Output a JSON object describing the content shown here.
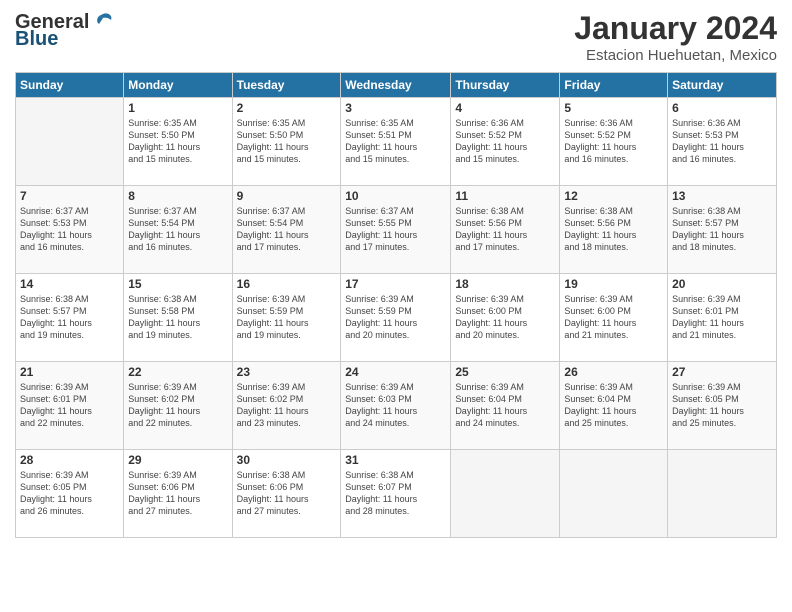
{
  "header": {
    "title": "January 2024",
    "location": "Estacion Huehuetan, Mexico"
  },
  "columns": [
    "Sunday",
    "Monday",
    "Tuesday",
    "Wednesday",
    "Thursday",
    "Friday",
    "Saturday"
  ],
  "weeks": [
    [
      {
        "day": "",
        "info": ""
      },
      {
        "day": "1",
        "info": "Sunrise: 6:35 AM\nSunset: 5:50 PM\nDaylight: 11 hours\nand 15 minutes."
      },
      {
        "day": "2",
        "info": "Sunrise: 6:35 AM\nSunset: 5:50 PM\nDaylight: 11 hours\nand 15 minutes."
      },
      {
        "day": "3",
        "info": "Sunrise: 6:35 AM\nSunset: 5:51 PM\nDaylight: 11 hours\nand 15 minutes."
      },
      {
        "day": "4",
        "info": "Sunrise: 6:36 AM\nSunset: 5:52 PM\nDaylight: 11 hours\nand 15 minutes."
      },
      {
        "day": "5",
        "info": "Sunrise: 6:36 AM\nSunset: 5:52 PM\nDaylight: 11 hours\nand 16 minutes."
      },
      {
        "day": "6",
        "info": "Sunrise: 6:36 AM\nSunset: 5:53 PM\nDaylight: 11 hours\nand 16 minutes."
      }
    ],
    [
      {
        "day": "7",
        "info": "Sunrise: 6:37 AM\nSunset: 5:53 PM\nDaylight: 11 hours\nand 16 minutes."
      },
      {
        "day": "8",
        "info": "Sunrise: 6:37 AM\nSunset: 5:54 PM\nDaylight: 11 hours\nand 16 minutes."
      },
      {
        "day": "9",
        "info": "Sunrise: 6:37 AM\nSunset: 5:54 PM\nDaylight: 11 hours\nand 17 minutes."
      },
      {
        "day": "10",
        "info": "Sunrise: 6:37 AM\nSunset: 5:55 PM\nDaylight: 11 hours\nand 17 minutes."
      },
      {
        "day": "11",
        "info": "Sunrise: 6:38 AM\nSunset: 5:56 PM\nDaylight: 11 hours\nand 17 minutes."
      },
      {
        "day": "12",
        "info": "Sunrise: 6:38 AM\nSunset: 5:56 PM\nDaylight: 11 hours\nand 18 minutes."
      },
      {
        "day": "13",
        "info": "Sunrise: 6:38 AM\nSunset: 5:57 PM\nDaylight: 11 hours\nand 18 minutes."
      }
    ],
    [
      {
        "day": "14",
        "info": "Sunrise: 6:38 AM\nSunset: 5:57 PM\nDaylight: 11 hours\nand 19 minutes."
      },
      {
        "day": "15",
        "info": "Sunrise: 6:38 AM\nSunset: 5:58 PM\nDaylight: 11 hours\nand 19 minutes."
      },
      {
        "day": "16",
        "info": "Sunrise: 6:39 AM\nSunset: 5:59 PM\nDaylight: 11 hours\nand 19 minutes."
      },
      {
        "day": "17",
        "info": "Sunrise: 6:39 AM\nSunset: 5:59 PM\nDaylight: 11 hours\nand 20 minutes."
      },
      {
        "day": "18",
        "info": "Sunrise: 6:39 AM\nSunset: 6:00 PM\nDaylight: 11 hours\nand 20 minutes."
      },
      {
        "day": "19",
        "info": "Sunrise: 6:39 AM\nSunset: 6:00 PM\nDaylight: 11 hours\nand 21 minutes."
      },
      {
        "day": "20",
        "info": "Sunrise: 6:39 AM\nSunset: 6:01 PM\nDaylight: 11 hours\nand 21 minutes."
      }
    ],
    [
      {
        "day": "21",
        "info": "Sunrise: 6:39 AM\nSunset: 6:01 PM\nDaylight: 11 hours\nand 22 minutes."
      },
      {
        "day": "22",
        "info": "Sunrise: 6:39 AM\nSunset: 6:02 PM\nDaylight: 11 hours\nand 22 minutes."
      },
      {
        "day": "23",
        "info": "Sunrise: 6:39 AM\nSunset: 6:02 PM\nDaylight: 11 hours\nand 23 minutes."
      },
      {
        "day": "24",
        "info": "Sunrise: 6:39 AM\nSunset: 6:03 PM\nDaylight: 11 hours\nand 24 minutes."
      },
      {
        "day": "25",
        "info": "Sunrise: 6:39 AM\nSunset: 6:04 PM\nDaylight: 11 hours\nand 24 minutes."
      },
      {
        "day": "26",
        "info": "Sunrise: 6:39 AM\nSunset: 6:04 PM\nDaylight: 11 hours\nand 25 minutes."
      },
      {
        "day": "27",
        "info": "Sunrise: 6:39 AM\nSunset: 6:05 PM\nDaylight: 11 hours\nand 25 minutes."
      }
    ],
    [
      {
        "day": "28",
        "info": "Sunrise: 6:39 AM\nSunset: 6:05 PM\nDaylight: 11 hours\nand 26 minutes."
      },
      {
        "day": "29",
        "info": "Sunrise: 6:39 AM\nSunset: 6:06 PM\nDaylight: 11 hours\nand 27 minutes."
      },
      {
        "day": "30",
        "info": "Sunrise: 6:38 AM\nSunset: 6:06 PM\nDaylight: 11 hours\nand 27 minutes."
      },
      {
        "day": "31",
        "info": "Sunrise: 6:38 AM\nSunset: 6:07 PM\nDaylight: 11 hours\nand 28 minutes."
      },
      {
        "day": "",
        "info": ""
      },
      {
        "day": "",
        "info": ""
      },
      {
        "day": "",
        "info": ""
      }
    ]
  ]
}
